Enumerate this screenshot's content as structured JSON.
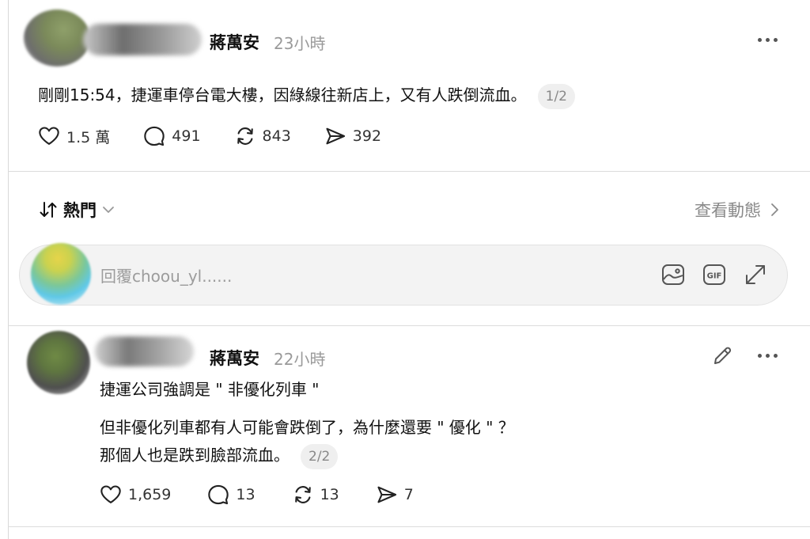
{
  "post": {
    "username": "蔣萬安",
    "time": "23小時",
    "text": "剛剛15:54，捷運車停台電大樓，因綠線往新店上，又有人跌倒流血。",
    "page_badge": "1/2",
    "likes": "1.5 萬",
    "comments": "491",
    "reposts": "843",
    "shares": "392"
  },
  "sort": {
    "label": "熱門",
    "activity_link": "查看動態"
  },
  "reply": {
    "placeholder": "回覆choou_yl......"
  },
  "reply_post": {
    "username": "蔣萬安",
    "time": "22小時",
    "line1": "捷運公司強調是 \" 非優化列車 \"",
    "line2": "但非優化列車都有人可能會跌倒了，為什麼還要 \" 優化 \" ？",
    "line3": "那個人也是跌到臉部流血。",
    "page_badge": "2/2",
    "likes": "1,659",
    "comments": "13",
    "reposts": "13",
    "shares": "7"
  },
  "icons": {
    "like": "heart-icon",
    "comment": "comment-bubble-icon",
    "repost": "repost-icon",
    "share": "send-icon",
    "sort": "sort-arrows-icon",
    "chevron": "chevron-icon",
    "image": "image-icon",
    "gif": "gif-icon",
    "expand": "expand-icon",
    "edit": "pencil-icon",
    "more": "more-icon"
  },
  "colors": {
    "text": "#111111",
    "muted": "#9a9a9a",
    "divider": "#dcdcdc",
    "reply_box_bg": "#f3f3f3"
  }
}
